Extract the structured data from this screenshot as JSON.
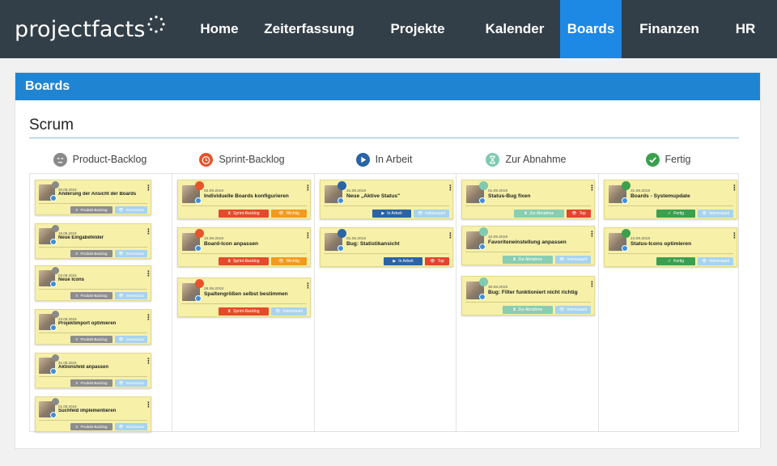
{
  "logo": {
    "text": "projectfacts"
  },
  "nav": [
    {
      "label": "Home",
      "active": false
    },
    {
      "label": "Zeiterfassung",
      "active": false
    },
    {
      "label": "Projekte",
      "active": false
    },
    {
      "label": "Kalender",
      "active": false
    },
    {
      "label": "Boards",
      "active": true
    },
    {
      "label": "Finanzen",
      "active": false
    },
    {
      "label": "HR",
      "active": false
    }
  ],
  "panel": {
    "title": "Boards"
  },
  "board": {
    "title": "Scrum"
  },
  "columns": [
    {
      "title": "Product-Backlog",
      "icon": "sleep-face-icon",
      "color": "#8a8a8a",
      "cards": [
        {
          "date": "30.09.2019",
          "title": "Änderung der Ansicht der Boards",
          "tags": [
            "Produkt-Backlog",
            "Interessant"
          ]
        },
        {
          "date": "19.08.2019",
          "title": "Neue Eingabefelder",
          "tags": [
            "Produkt-Backlog",
            "Interessant"
          ]
        },
        {
          "date": "02.09.2019",
          "title": "Neue Icons",
          "tags": [
            "Produkt-Backlog",
            "Interessant"
          ]
        },
        {
          "date": "23.09.2019",
          "title": "Projektimport optimieren",
          "tags": [
            "Produkt-Backlog",
            "Interessant"
          ]
        },
        {
          "date": "31.08.2019",
          "title": "Aktionsfeld anpassen",
          "tags": [
            "Produkt-Backlog",
            "Interessant"
          ]
        },
        {
          "date": "01.08.2019",
          "title": "Suchfeld implementieren",
          "tags": [
            "Produkt-Backlog",
            "Interessant"
          ]
        }
      ]
    },
    {
      "title": "Sprint-Backlog",
      "icon": "alarm-face-icon",
      "color": "#e8532b",
      "cards": [
        {
          "date": "02.09.2019",
          "title": "Individuelle Boards konfigurieren",
          "tags": [
            "Sprint-Backlog",
            "Wichtig"
          ]
        },
        {
          "date": "10.09.2019",
          "title": "Board-Icon anpassen",
          "tags": [
            "Sprint-Backlog",
            "Wichtig"
          ]
        },
        {
          "date": "25.09.2019",
          "title": "Spaltengrößen selbst bestimmen",
          "tags": [
            "Sprint-Backlog",
            "Interessant"
          ]
        }
      ]
    },
    {
      "title": "In Arbeit",
      "icon": "play-icon",
      "color": "#2864a6",
      "cards": [
        {
          "date": "31.08.2019",
          "title": "Neue „Aktive Status\"",
          "tags": [
            "In Arbeit",
            "Interessant"
          ]
        },
        {
          "date": "01.08.2019",
          "title": "Bug: Statistikansicht",
          "tags": [
            "In Arbeit",
            "Top"
          ]
        }
      ]
    },
    {
      "title": "Zur Abnahme",
      "icon": "hourglass-icon",
      "color": "#7fcab0",
      "cards": [
        {
          "date": "01.09.2019",
          "title": "Status-Bug fixen",
          "tags": [
            "Zur Abnahme",
            "Top"
          ]
        },
        {
          "date": "12.09.2019",
          "title": "Favoriteneinstellung anpassen",
          "tags": [
            "Zur Abnahme",
            "Interessant"
          ]
        },
        {
          "date": "30.08.2019",
          "title": "Bug: Filter funktioniert nicht richtig",
          "tags": [
            "Zur Abnahme",
            "Interessant"
          ]
        }
      ]
    },
    {
      "title": "Fertig",
      "icon": "check-icon",
      "color": "#3aa050",
      "cards": [
        {
          "date": "31.08.2019",
          "title": "Boards - Systemupdate",
          "tags": [
            "Fertig",
            "Interessant"
          ]
        },
        {
          "date": "24.09.2019",
          "title": "Status-Icons optimieren",
          "tags": [
            "Fertig",
            "Interessant"
          ]
        }
      ]
    }
  ],
  "tag_styles": {
    "Produkt-Backlog": {
      "bg": "#8d8d8d",
      "icon": "≡"
    },
    "Sprint-Backlog": {
      "bg": "#e54b2a",
      "icon": "⧗"
    },
    "In Arbeit": {
      "bg": "#2b63a6",
      "icon": "▶"
    },
    "Zur Abnahme": {
      "bg": "#89cdb3",
      "icon": "⧗"
    },
    "Fertig": {
      "bg": "#3aa050",
      "icon": "✓"
    },
    "Interessant": {
      "bg": "#a7d3ee",
      "icon": "👁"
    },
    "Wichtig": {
      "bg": "#f29a1e",
      "icon": "👁"
    },
    "Top": {
      "bg": "#e5432e",
      "icon": "👁"
    }
  }
}
